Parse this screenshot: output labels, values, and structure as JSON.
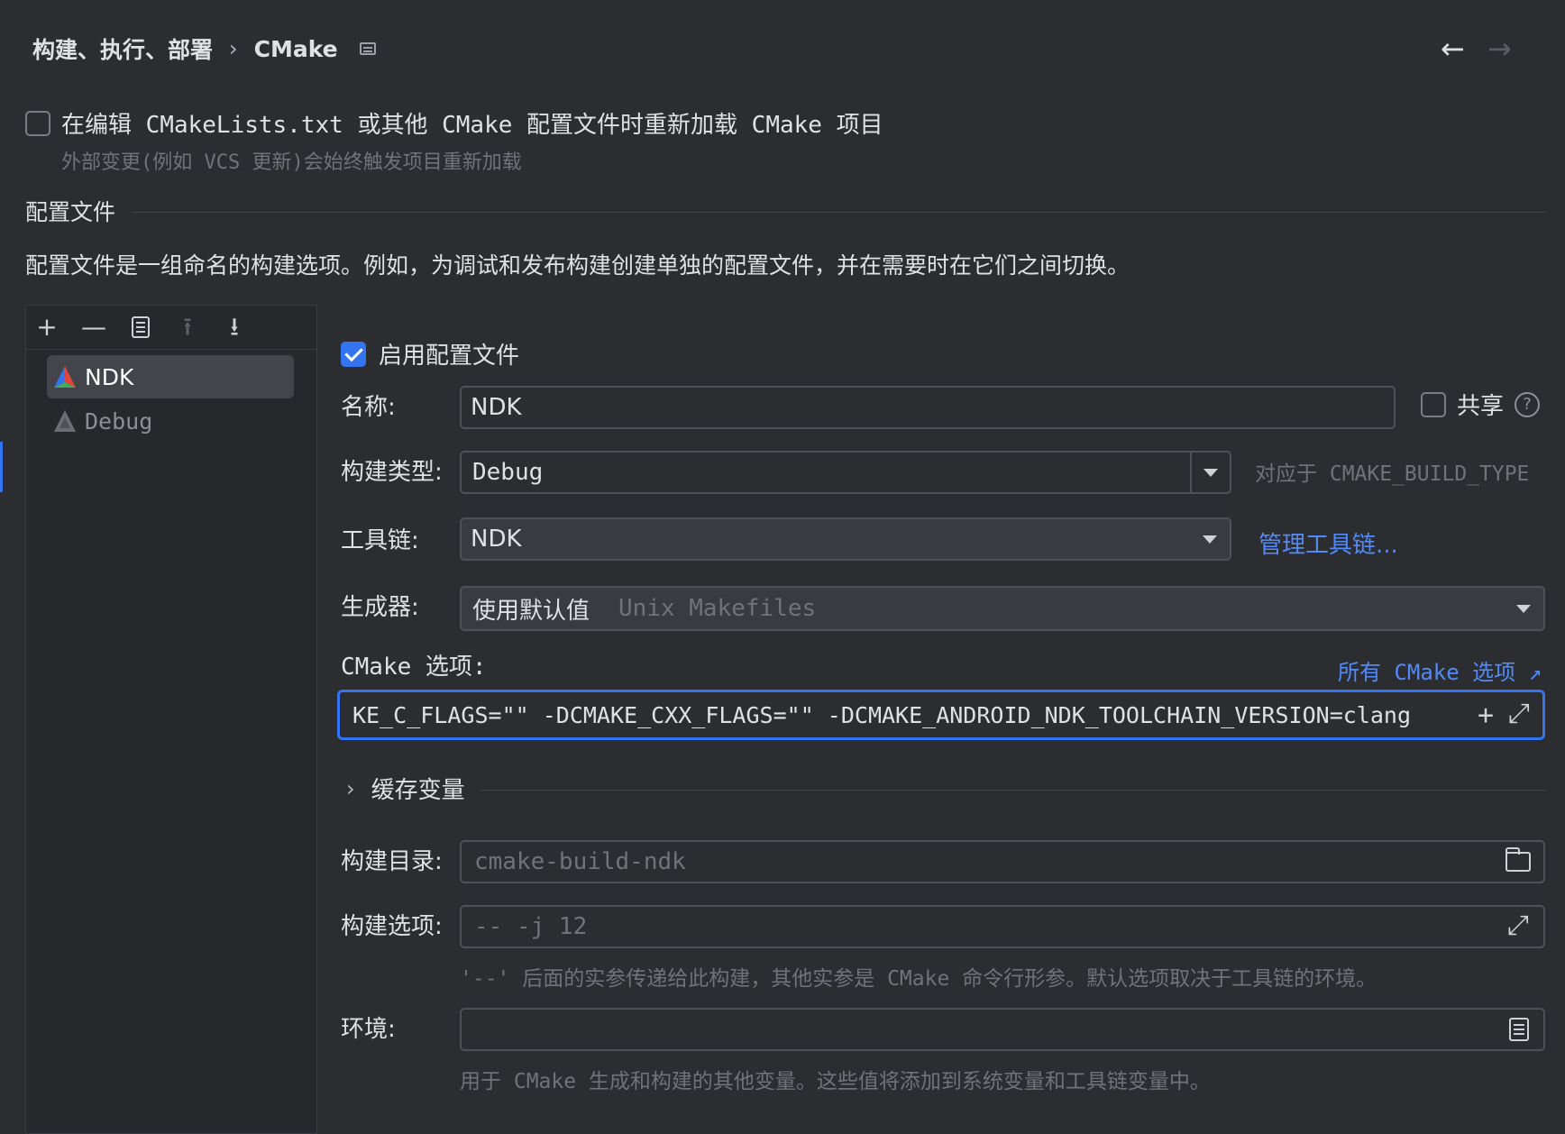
{
  "header": {
    "breadcrumb_parent": "构建、执行、部署",
    "breadcrumb_sep": "›",
    "breadcrumb_current": "CMake",
    "back_glyph": "←",
    "forward_glyph": "→"
  },
  "reload": {
    "label": "在编辑 CMakeLists.txt 或其他 CMake 配置文件时重新加载 CMake 项目",
    "hint": "外部变更(例如 VCS 更新)会始终触发项目重新加载",
    "checked": false
  },
  "profiles_section": {
    "title": "配置文件",
    "description": "配置文件是一组命名的构建选项。例如，为调试和发布构建创建单独的配置文件，并在需要时在它们之间切换。"
  },
  "toolbar": {
    "add": "+",
    "remove": "—",
    "up": "⭱",
    "down": "⭳"
  },
  "profiles": [
    {
      "name": "NDK",
      "selected": true
    },
    {
      "name": "Debug",
      "selected": false
    }
  ],
  "form": {
    "enable_label": "启用配置文件",
    "enable_checked": true,
    "name_label": "名称:",
    "name_value": "NDK",
    "share_label": "共享",
    "help_glyph": "?",
    "build_type_label": "构建类型:",
    "build_type_value": "Debug",
    "build_type_hint": "对应于 CMAKE_BUILD_TYPE",
    "toolchain_label": "工具链:",
    "toolchain_value": "NDK",
    "manage_toolchains_link": "管理工具链...",
    "generator_label": "生成器:",
    "generator_value": "使用默认值",
    "generator_default": "Unix Makefiles",
    "cmake_options_label": "CMake 选项:",
    "all_options_link": "所有 CMake 选项 ↗",
    "cmake_options_value": "KE_C_FLAGS=\"\" -DCMAKE_CXX_FLAGS=\"\" -DCMAKE_ANDROID_NDK_TOOLCHAIN_VERSION=clang",
    "cmake_add_glyph": "+",
    "cache_vars_label": "缓存变量",
    "build_dir_label": "构建目录:",
    "build_dir_placeholder": "cmake-build-ndk",
    "build_options_label": "构建选项:",
    "build_options_placeholder": "-- -j 12",
    "build_options_hint": "'--' 后面的实参传递给此构建，其他实参是 CMake 命令行形参。默认选项取决于工具链的环境。",
    "env_label": "环境:",
    "env_value": "",
    "env_hint": "用于 CMake 生成和构建的其他变量。这些值将添加到系统变量和工具链变量中。"
  },
  "colors": {
    "background": "#2b2d30",
    "accent": "#3574f0",
    "link": "#548af7"
  }
}
